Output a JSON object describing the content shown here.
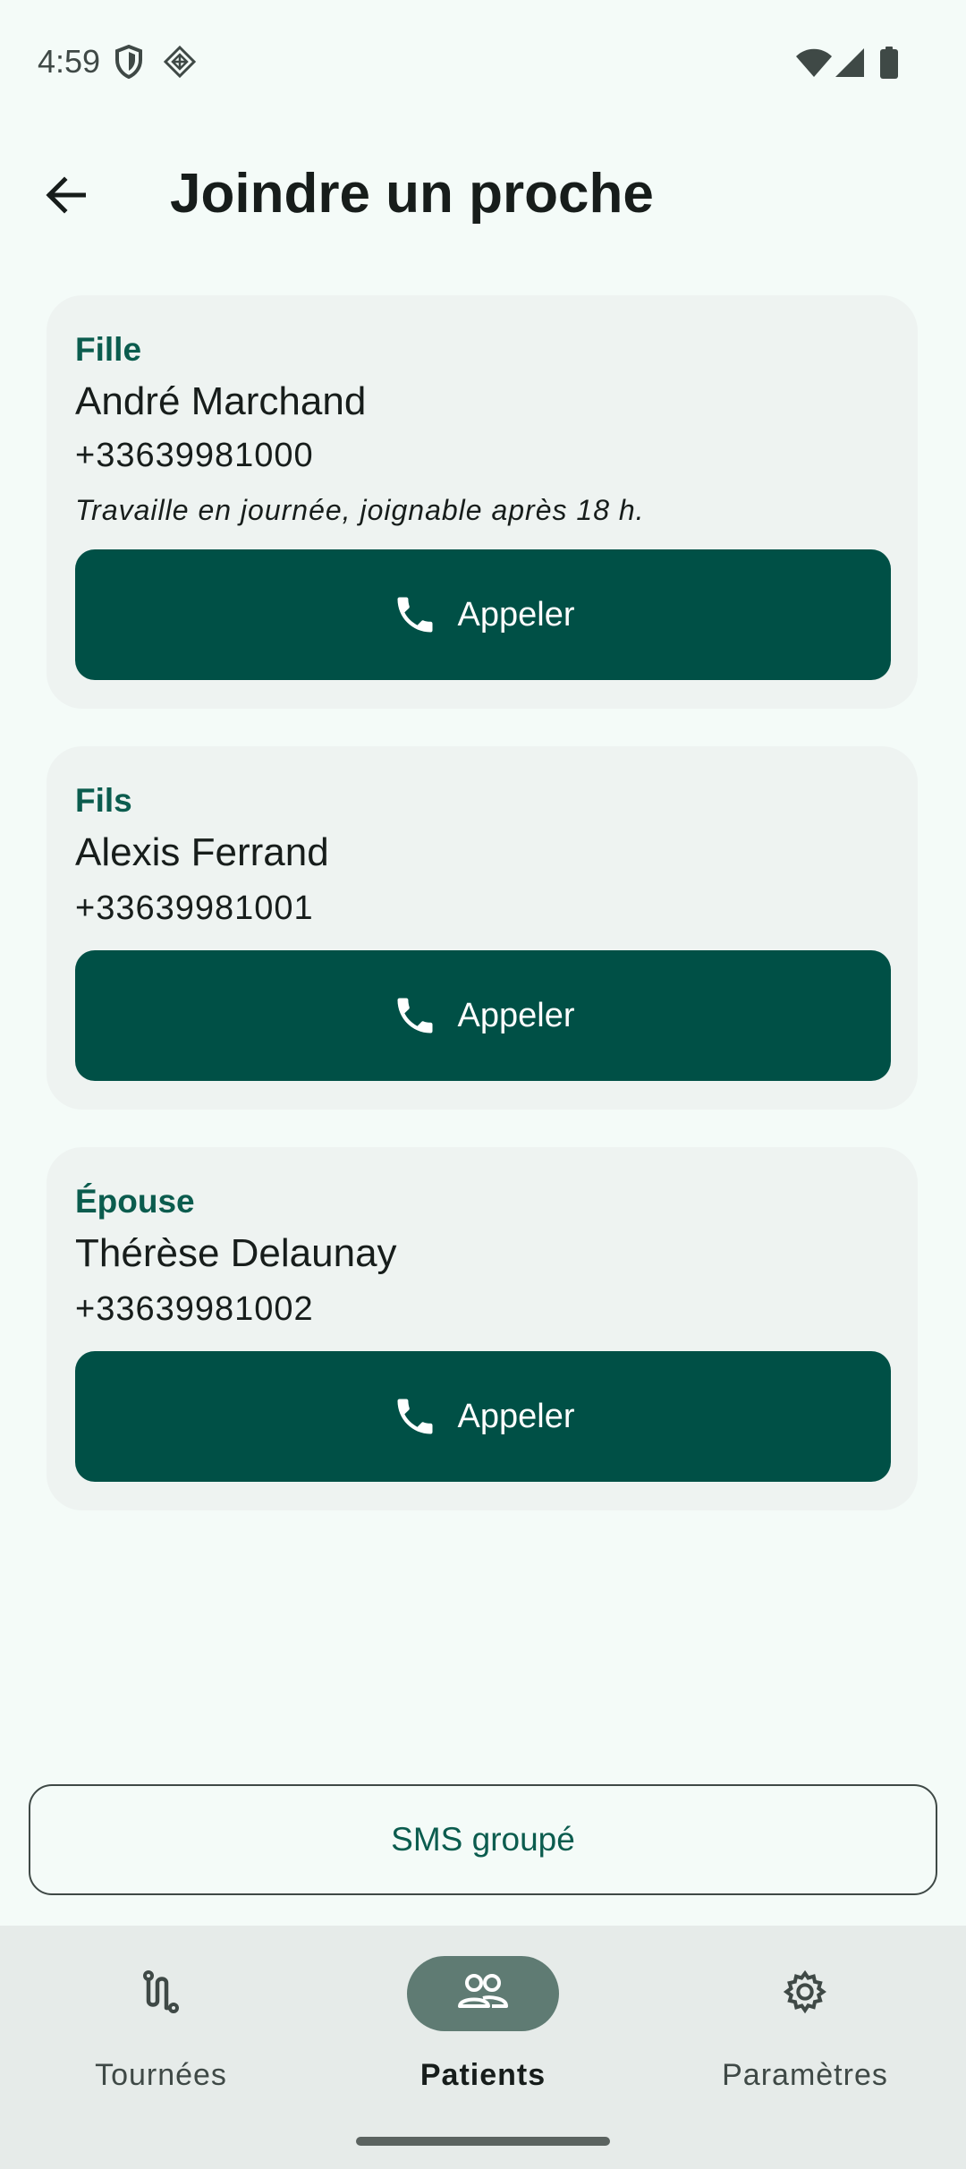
{
  "status_bar": {
    "time": "4:59",
    "icons": [
      "shield-icon",
      "app-notification-icon",
      "wifi-icon",
      "signal-icon",
      "battery-icon"
    ]
  },
  "app_bar": {
    "title": "Joindre un proche",
    "back_icon": "arrow-back-icon"
  },
  "contacts": [
    {
      "relation": "Fille",
      "name": "André Marchand",
      "phone": "+33639981000",
      "note": "Travaille en journée, joignable après 18 h.",
      "call_label": "Appeler"
    },
    {
      "relation": "Fils",
      "name": "Alexis Ferrand",
      "phone": "+33639981001",
      "call_label": "Appeler"
    },
    {
      "relation": "Épouse",
      "name": "Thérèse Delaunay",
      "phone": "+33639981002",
      "call_label": "Appeler"
    }
  ],
  "sms_button": {
    "label": "SMS groupé"
  },
  "bottom_nav": {
    "items": [
      {
        "label": "Tournées",
        "icon": "route-icon",
        "active": false
      },
      {
        "label": "Patients",
        "icon": "people-icon",
        "active": true
      },
      {
        "label": "Paramètres",
        "icon": "gear-icon",
        "active": false
      }
    ]
  },
  "colors": {
    "primary": "#005046",
    "accent_text": "#0b5c4e",
    "background": "#f4fbf8",
    "card": "#eef3f1",
    "nav_background": "#e6ebe9",
    "nav_active_pill": "#5f7b73"
  }
}
